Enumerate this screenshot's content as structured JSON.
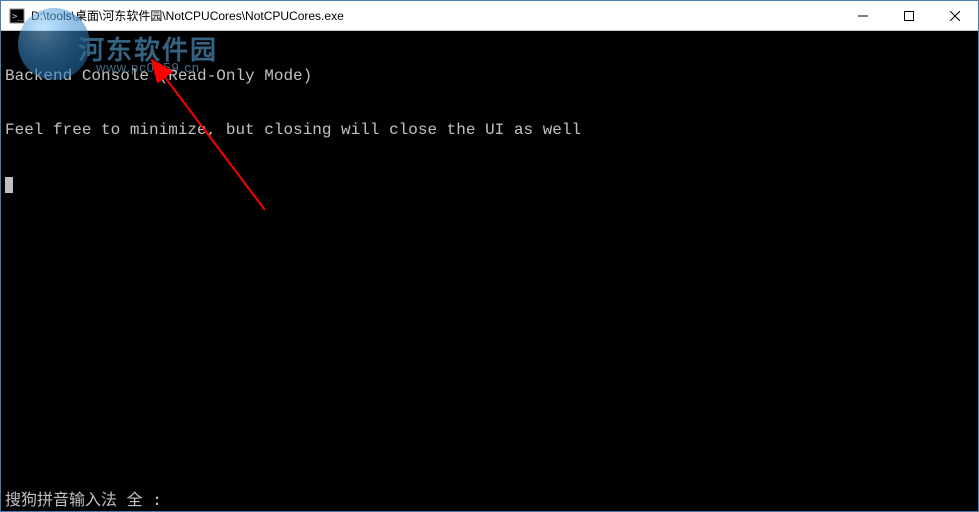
{
  "titlebar": {
    "path": "D:\\tools\\桌面\\河东软件园\\NotCPUCores\\NotCPUCores.exe"
  },
  "window_controls": {
    "minimize": "—",
    "maximize": "☐",
    "close": "✕"
  },
  "console": {
    "line1": "Backend Console (Read-Only Mode)",
    "line2": "Feel free to minimize, but closing will close the UI as well"
  },
  "ime": {
    "status": "搜狗拼音输入法 全 :"
  },
  "watermark": {
    "text": "河东软件园",
    "url": "www.pc0359.cn"
  }
}
